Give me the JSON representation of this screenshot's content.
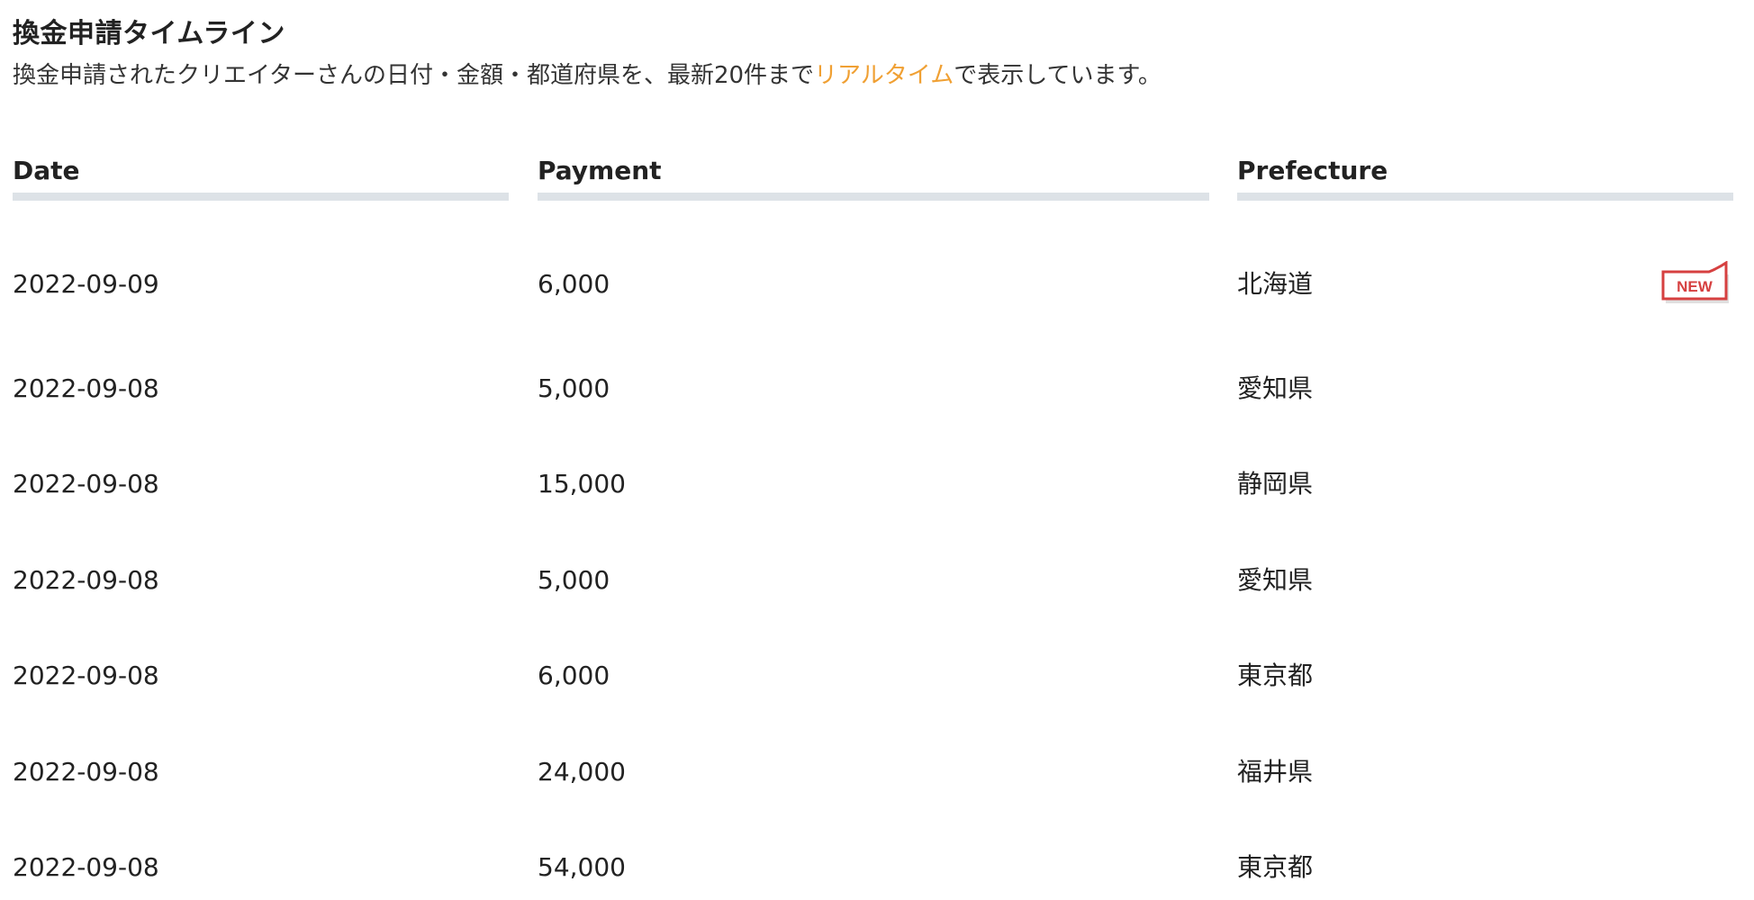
{
  "header": {
    "title": "換金申請タイムライン",
    "description_before": "換金申請されたクリエイターさんの日付・金額・都道府県を、最新20件まで",
    "description_link": "リアルタイム",
    "description_after": "で表示しています。"
  },
  "table": {
    "columns": [
      "Date",
      "Payment",
      "Prefecture"
    ],
    "new_badge_label": "NEW",
    "colors": {
      "accent": "#f0a033",
      "header_bar": "#dde2e7",
      "badge": "#d64040"
    },
    "rows": [
      {
        "date": "2022-09-09",
        "payment": "6,000",
        "prefecture": "北海道",
        "is_new": true
      },
      {
        "date": "2022-09-08",
        "payment": "5,000",
        "prefecture": "愛知県",
        "is_new": false
      },
      {
        "date": "2022-09-08",
        "payment": "15,000",
        "prefecture": "静岡県",
        "is_new": false
      },
      {
        "date": "2022-09-08",
        "payment": "5,000",
        "prefecture": "愛知県",
        "is_new": false
      },
      {
        "date": "2022-09-08",
        "payment": "6,000",
        "prefecture": "東京都",
        "is_new": false
      },
      {
        "date": "2022-09-08",
        "payment": "24,000",
        "prefecture": "福井県",
        "is_new": false
      },
      {
        "date": "2022-09-08",
        "payment": "54,000",
        "prefecture": "東京都",
        "is_new": false
      }
    ]
  }
}
